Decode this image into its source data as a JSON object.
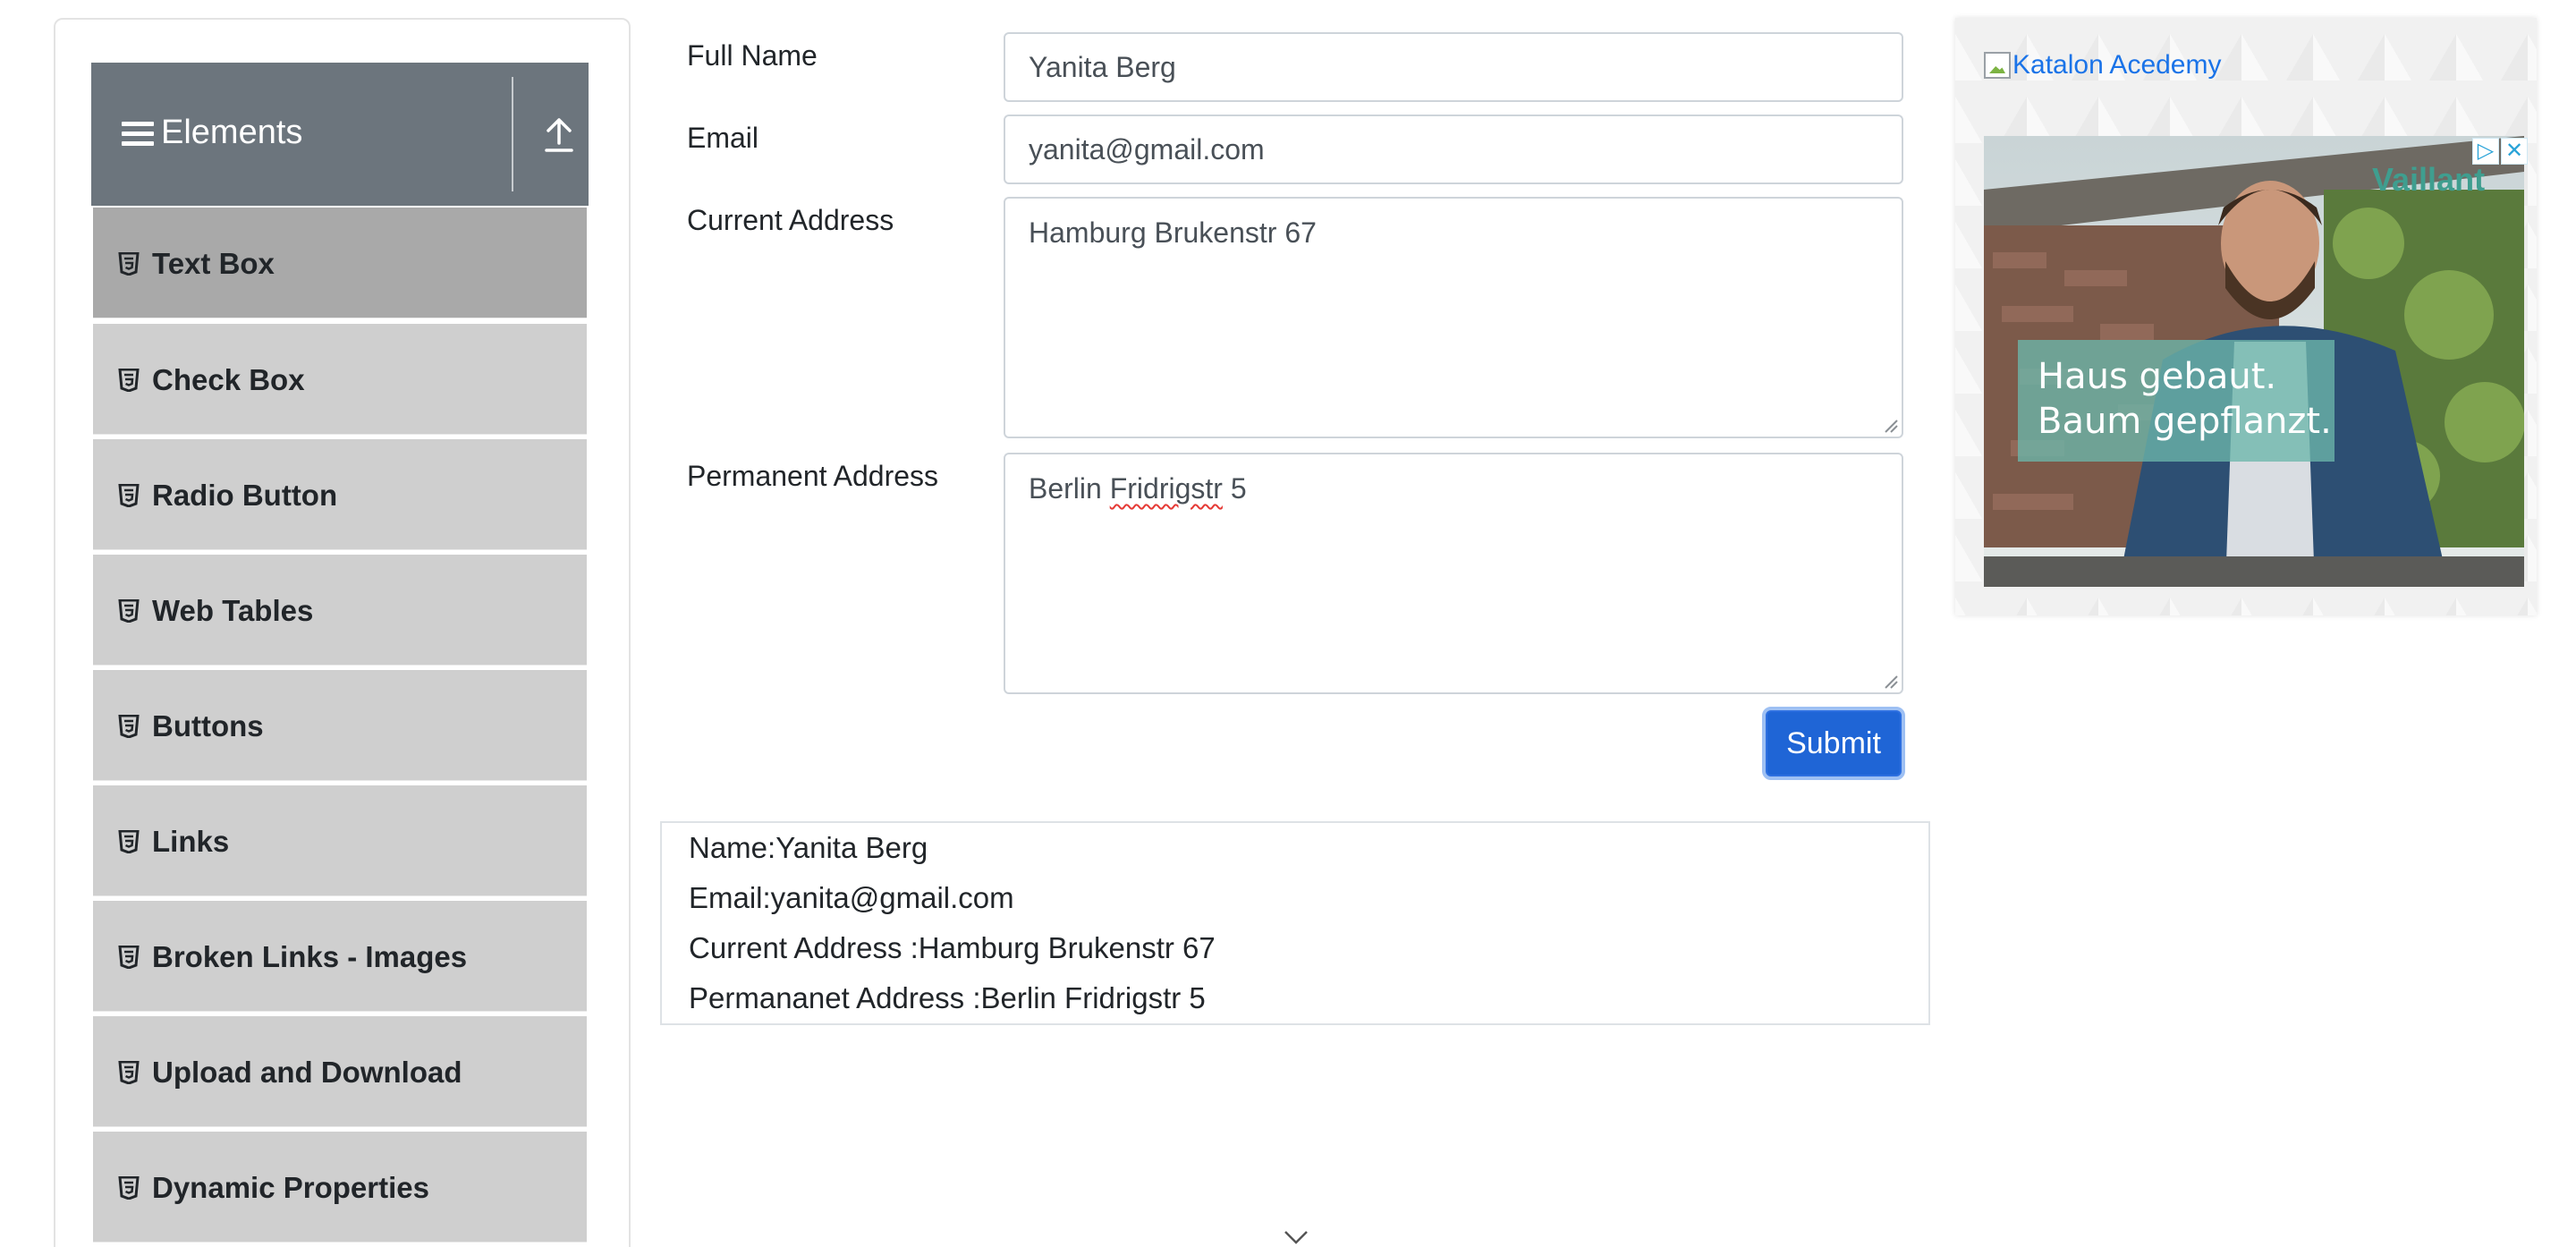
{
  "sidebar": {
    "group_title": "Elements",
    "items": [
      {
        "label": "Text Box",
        "active": true
      },
      {
        "label": "Check Box"
      },
      {
        "label": "Radio Button"
      },
      {
        "label": "Web Tables"
      },
      {
        "label": "Buttons"
      },
      {
        "label": "Links"
      },
      {
        "label": "Broken Links - Images"
      },
      {
        "label": "Upload and Download"
      },
      {
        "label": "Dynamic Properties"
      }
    ]
  },
  "form": {
    "full_name": {
      "label": "Full Name",
      "value": "Yanita Berg"
    },
    "email": {
      "label": "Email",
      "value": "yanita@gmail.com"
    },
    "current_address": {
      "label": "Current Address",
      "value": "Hamburg Brukenstr 67"
    },
    "permanent_address": {
      "label": "Permanent Address",
      "value_prefix": "Berlin ",
      "value_misspelled": "Fridrigstr",
      "value_suffix": " 5"
    },
    "submit_label": "Submit"
  },
  "output": {
    "name": "Name:Yanita Berg",
    "email": "Email:yanita@gmail.com",
    "current_address": "Current Address :Hamburg Brukenstr 67",
    "permanent_address": "Permananet Address :Berlin Fridrigstr 5"
  },
  "ad": {
    "link_text": "Katalon Acedemy",
    "headline_line1": "Haus gebaut.",
    "headline_line2": "Baum gepflanzt.",
    "brand": "Vaillant",
    "adchoices_icon": "adchoices-icon",
    "close_icon": "close-icon"
  },
  "colors": {
    "header_bg": "#6c757d",
    "menu_bg": "#cfcfcf",
    "menu_active_bg": "#a9a9a9",
    "submit_bg": "#1f65d6",
    "link": "#1a73e8"
  }
}
